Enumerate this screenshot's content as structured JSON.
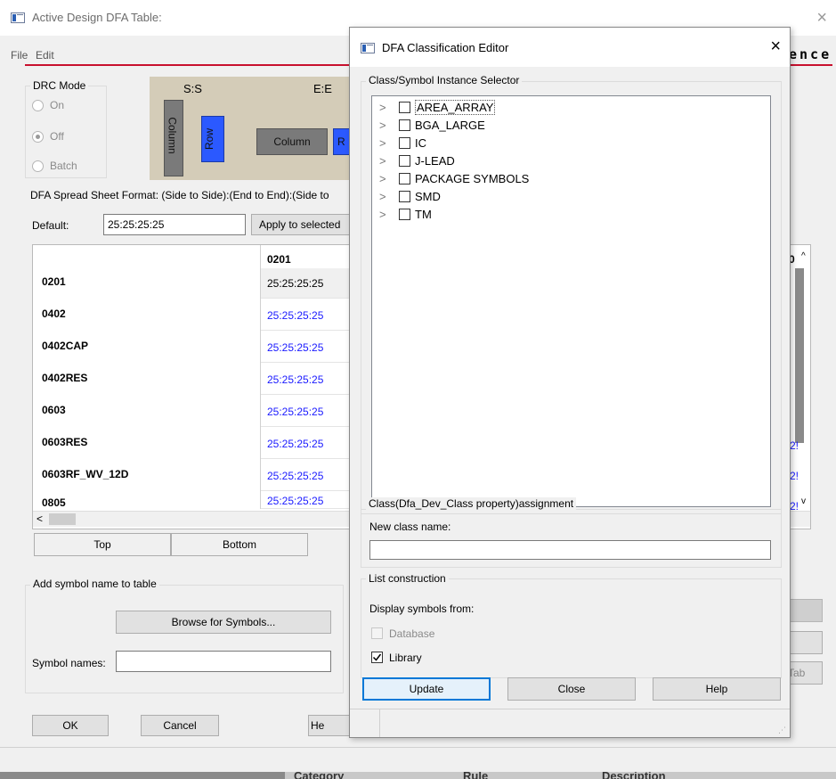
{
  "main": {
    "title": "Active Design DFA Table:",
    "close_glyph": "×",
    "menu": [
      "File",
      "Edit"
    ],
    "brand_partial": "ence",
    "drc_mode": {
      "label": "DRC Mode",
      "options": [
        "On",
        "Off",
        "Batch"
      ],
      "selected": "Off"
    },
    "preview": {
      "ss": "S:S",
      "ee": "E:E",
      "column": "Column",
      "row": "Row",
      "column2": "Column",
      "row2_partial": "R"
    },
    "spreadsheet_format": "DFA Spread Sheet Format: (Side to Side):(End to End):(Side to",
    "default_label": "Default:",
    "default_value": "25:25:25:25",
    "apply_button": "Apply to selected",
    "table": {
      "column_header": "0201",
      "right_header_partial": "0",
      "rows": [
        {
          "label": "0201",
          "value": "25:25:25:25"
        },
        {
          "label": "0402",
          "value": "25:25:25:25"
        },
        {
          "label": "0402CAP",
          "value": "25:25:25:25"
        },
        {
          "label": "0402RES",
          "value": "25:25:25:25"
        },
        {
          "label": "0603",
          "value": "25:25:25:25"
        },
        {
          "label": "0603RES",
          "value": "25:25:25:25"
        },
        {
          "label": "0603RF_WV_12D",
          "value": "25:25:25:25"
        },
        {
          "label": "0805",
          "value": "25:25:25:25"
        }
      ],
      "right_partial": "2!"
    },
    "tabs": [
      "Top",
      "Bottom"
    ],
    "add_symbol": {
      "label": "Add symbol name to table",
      "browse": "Browse for Symbols...",
      "names_label": "Symbol names:",
      "names_value": ""
    },
    "right_partial_btn": "Tab",
    "buttons": {
      "ok": "OK",
      "cancel": "Cancel",
      "help_partial": "He"
    },
    "bottom_headers": [
      "Category",
      "Rule",
      "Description"
    ]
  },
  "dialog": {
    "title": "DFA Classification Editor",
    "close_glyph": "×",
    "selector_label": "Class/Symbol Instance Selector",
    "tree_items": [
      "AREA_ARRAY",
      "BGA_LARGE",
      "IC",
      "J-LEAD",
      "PACKAGE SYMBOLS",
      "SMD",
      "TM"
    ],
    "assignment_label": "Class(Dfa_Dev_Class property)assignment",
    "new_class_label": "New class name:",
    "new_class_value": "",
    "list_construction_label": "List construction",
    "display_from_label": "Display symbols from:",
    "database_label": "Database",
    "database_checked": false,
    "library_label": "Library",
    "library_checked": true,
    "buttons": {
      "update": "Update",
      "close": "Close",
      "help": "Help"
    }
  },
  "colors": {
    "accent_red": "#c8102e",
    "row_blue": "#2b59ff",
    "link_blue": "#1a1aff",
    "focus_blue": "#0078d7"
  }
}
